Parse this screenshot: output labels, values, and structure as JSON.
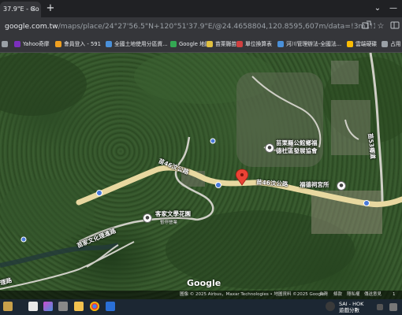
{
  "browser": {
    "tab_title": "37.9\"E - Go",
    "tab_close": "×",
    "new_tab": "+",
    "window_controls": {
      "chevron": "⌄",
      "minimize": "—"
    },
    "url_host": "google.com.tw",
    "url_rest": "/maps/place/24°27'56.5\"N+120°51'37.9\"E/@24.4658804,120.8595,607m/data=!3m1!1e3!4m3!3m2!8m2!3d24....",
    "toolbar_icons": [
      "share-icon",
      "star-icon",
      "extension-icon"
    ]
  },
  "bookmarks": [
    {
      "label": "",
      "color": "#9aa0a6"
    },
    {
      "label": "Yahoo奇摩",
      "color": "#7b2fbe"
    },
    {
      "label": "會員登入 - 591",
      "color": "#f0a020"
    },
    {
      "label": "全國土地使用分區資...",
      "color": "#4a90d9"
    },
    {
      "label": "Google 地圖",
      "color": "#34a853"
    },
    {
      "label": "苗栗縣苗...",
      "color": "#e0c040"
    },
    {
      "label": "單位換算表",
      "color": "#d04040"
    },
    {
      "label": "河川管理辦法-全國法...",
      "color": "#4a90d9"
    },
    {
      "label": "雲端硬碟",
      "color": "#fbbc04"
    },
    {
      "label": "占用",
      "color": "#9aa0a6"
    }
  ],
  "map": {
    "roads": {
      "main_east": "苗46汶公路",
      "main_mid": "苗46汶公路",
      "vertical_right": "苗53鄉道",
      "lower_left": "苗家文化理進路",
      "bottom_left": "理路"
    },
    "pois": {
      "association_line1": "苗栗縣公館鄉福",
      "association_line2": "德社區發展協會",
      "hakka_garden": "客家文學花園",
      "hakka_garden_status": "暫停營業",
      "temple": "福德祠宮所"
    },
    "logo": "Google",
    "attribution_left": "圖像 © 2025 Airbus，Maxar Technologies • 地圖資料 ©2025 Google",
    "attribution_right": [
      "台灣",
      "條款",
      "隱私權",
      "傳送意見",
      "1"
    ]
  },
  "taskbar": {
    "tray_line1": "SAI - HOK",
    "tray_line2": "遊戲分數"
  }
}
